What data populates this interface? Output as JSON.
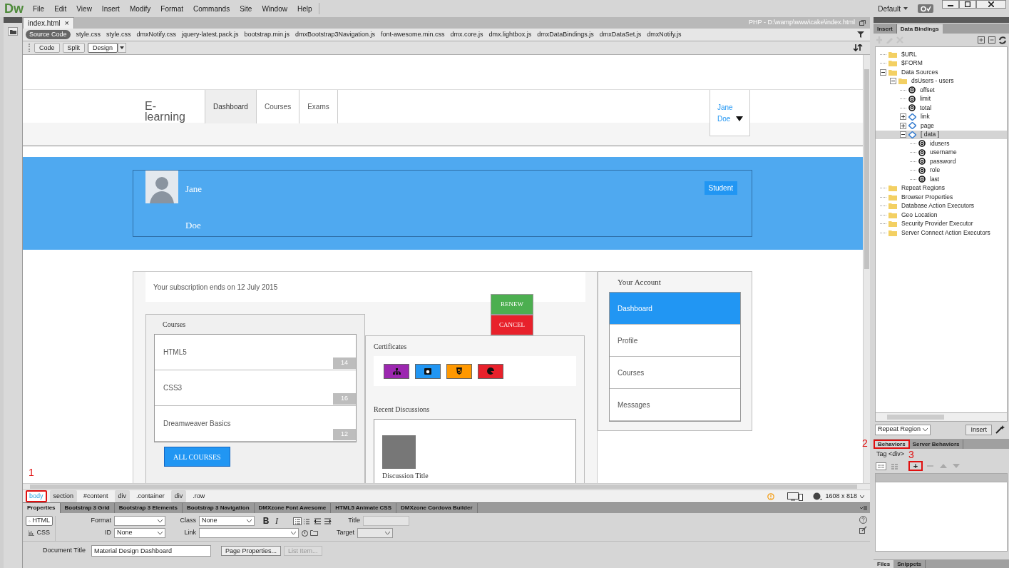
{
  "app": {
    "logo": "Dw",
    "menu": [
      "File",
      "Edit",
      "View",
      "Insert",
      "Modify",
      "Format",
      "Commands",
      "Site",
      "Window",
      "Help"
    ],
    "workspace": "Default"
  },
  "document": {
    "tab": "index.html",
    "close": "×",
    "path": "PHP - D:\\wamp\\www\\cake\\index.html",
    "related_files": [
      {
        "label": "Source Code",
        "selected": true
      },
      {
        "label": "style.css",
        "selected": false
      },
      {
        "label": "style.css",
        "selected": false
      },
      {
        "label": "dmxNotify.css",
        "selected": false
      },
      {
        "label": "jquery-latest.pack.js",
        "selected": false
      },
      {
        "label": "bootstrap.min.js",
        "selected": false
      },
      {
        "label": "dmxBootstrap3Navigation.js",
        "selected": false
      },
      {
        "label": "font-awesome.min.css",
        "selected": false
      },
      {
        "label": "dmx.core.js",
        "selected": false
      },
      {
        "label": "dmx.lightbox.js",
        "selected": false
      },
      {
        "label": "dmxDataBindings.js",
        "selected": false
      },
      {
        "label": "dmxDataSet.js",
        "selected": false
      },
      {
        "label": "dmxNotify.js",
        "selected": false
      }
    ],
    "views": [
      {
        "label": "Code",
        "selected": false
      },
      {
        "label": "Split",
        "selected": false
      },
      {
        "label": "Design",
        "selected": true
      }
    ]
  },
  "design": {
    "brand": "E-learning",
    "nav": [
      {
        "label": "Dashboard",
        "selected": true
      },
      {
        "label": "Courses",
        "selected": false
      },
      {
        "label": "Exams",
        "selected": false
      }
    ],
    "user_menu": "Jane Doe",
    "profile": {
      "first_name": "Jane",
      "last_name": "Doe",
      "role": "Student"
    },
    "subscription": "Your subscription ends on 12 July 2015",
    "actions": [
      {
        "label": "RENEW",
        "color": "#4caf50"
      },
      {
        "label": "CANCEL",
        "color": "#e8212b"
      }
    ],
    "courses": {
      "title": "Courses",
      "items": [
        {
          "name": "HTML5",
          "count": "14"
        },
        {
          "name": "CSS3",
          "count": "16"
        },
        {
          "name": "Dreamweaver Basics",
          "count": "12"
        }
      ],
      "button": "ALL COURSES"
    },
    "certificates": {
      "title": "Certificates",
      "badges": [
        {
          "kind": "sitemap",
          "color": "#9c27b0"
        },
        {
          "kind": "camera",
          "color": "#2196f3"
        },
        {
          "kind": "shield",
          "color": "#ff9800"
        },
        {
          "kind": "circle",
          "color": "#e8212b"
        }
      ]
    },
    "discussions": {
      "title": "Recent Discussions",
      "items": [
        {
          "title": "Discussion Title"
        }
      ]
    },
    "account": {
      "title": "Your Account",
      "items": [
        {
          "label": "Dashboard",
          "selected": true
        },
        {
          "label": "Profile",
          "selected": false
        },
        {
          "label": "Courses",
          "selected": false
        },
        {
          "label": "Messages",
          "selected": false
        }
      ]
    }
  },
  "tag_selector": {
    "items": [
      {
        "label": "body",
        "kind": "tag",
        "selected": true,
        "highlighted": true
      },
      {
        "label": "section",
        "kind": "tag",
        "selected": false,
        "highlighted": false
      },
      {
        "label": "#content",
        "kind": "selector",
        "selected": false,
        "highlighted": false
      },
      {
        "label": "div",
        "kind": "tag",
        "selected": false,
        "highlighted": false
      },
      {
        "label": ".container",
        "kind": "selector",
        "selected": false,
        "highlighted": false
      },
      {
        "label": "div",
        "kind": "tag",
        "selected": false,
        "highlighted": false
      },
      {
        "label": ".row",
        "kind": "selector",
        "selected": false,
        "highlighted": false
      }
    ],
    "size": "1608 x 818"
  },
  "properties": {
    "tabs": [
      {
        "label": "Properties",
        "selected": true
      },
      {
        "label": "Bootstrap 3 Grid",
        "selected": false
      },
      {
        "label": "Bootstrap 3 Elements",
        "selected": false
      },
      {
        "label": "Bootstrap 3 Navigation",
        "selected": false
      },
      {
        "label": "DMXzone Font Awesome",
        "selected": false
      },
      {
        "label": "HTML5 Animate CSS",
        "selected": false
      },
      {
        "label": "DMXzone Cordova Builder",
        "selected": false
      }
    ],
    "modes": [
      {
        "label": "HTML",
        "selected": true
      },
      {
        "label": "CSS",
        "selected": false
      }
    ],
    "format": {
      "label": "Format"
    },
    "id": {
      "label": "ID",
      "value": "None"
    },
    "class": {
      "label": "Class",
      "value": "None"
    },
    "link": {
      "label": "Link"
    },
    "bold": "B",
    "italic": "I",
    "title": {
      "label": "Title"
    },
    "target": {
      "label": "Target"
    },
    "document_title": {
      "label": "Document Title",
      "value": "Material Design Dashboard"
    },
    "buttons": [
      {
        "label": "Page Properties...",
        "disabled": false
      },
      {
        "label": "List Item...",
        "disabled": true
      }
    ]
  },
  "bindings": {
    "tabs": [
      {
        "label": "Insert",
        "selected": false
      },
      {
        "label": "Data Bindings",
        "selected": true
      }
    ],
    "tree": [
      {
        "label": "$URL",
        "kind": "folder",
        "selected": false
      },
      {
        "label": "$FORM",
        "kind": "folder",
        "selected": false
      },
      {
        "label": "Data Sources",
        "kind": "folder",
        "expanded": true,
        "selected": false,
        "children": [
          {
            "label": "dsUsers - users",
            "kind": "folder",
            "expanded": true,
            "selected": false,
            "children": [
              {
                "label": "offset",
                "kind": "field",
                "selected": false
              },
              {
                "label": "limit",
                "kind": "field",
                "selected": false
              },
              {
                "label": "total",
                "kind": "field",
                "selected": false
              },
              {
                "label": "link",
                "kind": "object",
                "expanded": false,
                "selected": false
              },
              {
                "label": "page",
                "kind": "object",
                "expanded": false,
                "selected": false
              },
              {
                "label": "[ data ]",
                "kind": "object",
                "expanded": true,
                "selected": true,
                "children": [
                  {
                    "label": "idusers",
                    "kind": "field",
                    "selected": false
                  },
                  {
                    "label": "username",
                    "kind": "field",
                    "selected": false
                  },
                  {
                    "label": "password",
                    "kind": "field",
                    "selected": false
                  },
                  {
                    "label": "role",
                    "kind": "field",
                    "selected": false
                  },
                  {
                    "label": "last",
                    "kind": "field",
                    "selected": false
                  }
                ]
              }
            ]
          }
        ]
      },
      {
        "label": "Repeat Regions",
        "kind": "folder",
        "selected": false
      },
      {
        "label": "Browser Properties",
        "kind": "folder",
        "selected": false
      },
      {
        "label": "Database Action Executors",
        "kind": "folder",
        "selected": false
      },
      {
        "label": "Geo Location",
        "kind": "folder",
        "selected": false
      },
      {
        "label": "Security Provider Executor",
        "kind": "folder",
        "selected": false
      },
      {
        "label": "Server Connect Action Executors",
        "kind": "folder",
        "selected": false
      }
    ],
    "repeat_select": "Repeat Region",
    "insert_button": "Insert"
  },
  "behaviors": {
    "tabs": [
      {
        "label": "Behaviors",
        "selected": true,
        "highlighted": true
      },
      {
        "label": "Server Behaviors",
        "selected": false,
        "highlighted": false
      }
    ],
    "tag": "Tag <div>",
    "add_button": {
      "label": "+",
      "highlighted": true
    }
  },
  "bottom_tabs": [
    {
      "label": "Files",
      "selected": true
    },
    {
      "label": "Snippets",
      "selected": false
    }
  ],
  "annotations": [
    "1",
    "2",
    "3"
  ]
}
